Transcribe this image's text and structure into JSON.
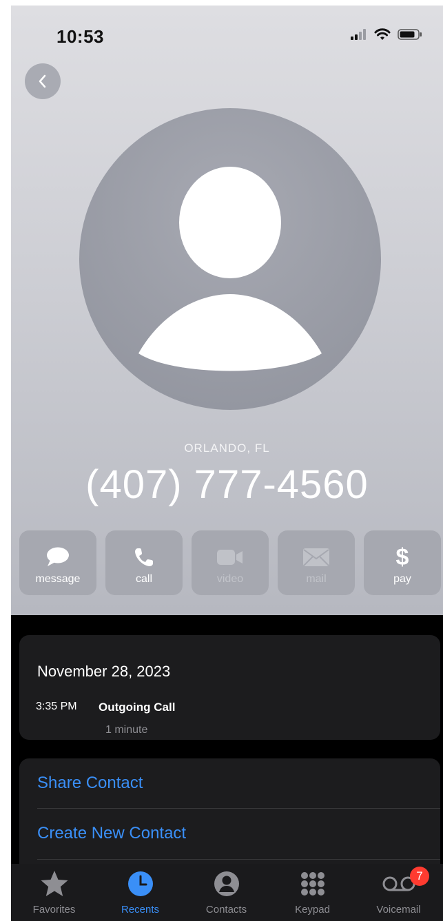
{
  "status_bar": {
    "time": "10:53"
  },
  "contact": {
    "location": "ORLANDO, FL",
    "phone": "(407) 777-4560"
  },
  "actions": [
    {
      "label": "message",
      "icon": "message-bubble-icon",
      "enabled": true
    },
    {
      "label": "call",
      "icon": "phone-icon",
      "enabled": true
    },
    {
      "label": "video",
      "icon": "video-camera-icon",
      "enabled": false
    },
    {
      "label": "mail",
      "icon": "envelope-icon",
      "enabled": false
    },
    {
      "label": "pay",
      "icon": "dollar-icon",
      "enabled": true
    }
  ],
  "call_log": {
    "date": "November 28, 2023",
    "time": "3:35 PM",
    "type": "Outgoing Call",
    "duration": "1 minute"
  },
  "options": {
    "share": "Share Contact",
    "create": "Create New Contact"
  },
  "tabbar": {
    "items": [
      {
        "label": "Favorites",
        "icon": "star-icon"
      },
      {
        "label": "Recents",
        "icon": "clock-icon",
        "active": true
      },
      {
        "label": "Contacts",
        "icon": "person-circle-icon"
      },
      {
        "label": "Keypad",
        "icon": "keypad-grid-icon"
      },
      {
        "label": "Voicemail",
        "icon": "voicemail-icon",
        "badge": "7"
      }
    ]
  },
  "colors": {
    "accent": "#3a8ff7",
    "badge": "#ff3b30",
    "card": "#1c1c1e"
  }
}
